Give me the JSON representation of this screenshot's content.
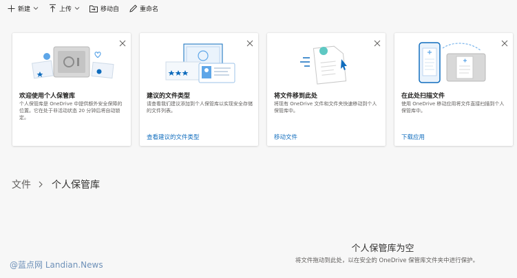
{
  "commandbar": {
    "new_label": "新建",
    "upload_label": "上传",
    "move_label": "移动自",
    "rename_label": "重命名"
  },
  "cards": [
    {
      "title": "欢迎使用个人保管库",
      "description": "个人保管库是 OneDrive 中提供额外安全保障的位置。它在处于非活动状态 20 分钟后将自动锁定。",
      "link": ""
    },
    {
      "title": "建议的文件类型",
      "description": "请查看我们建议添加到个人保管库以实现安全存储的文件列表。",
      "link": "查看建议的文件类型"
    },
    {
      "title": "将文件移到此处",
      "description": "将现有 OneDrive 文件和文件夹快速移动到个人保管库中。",
      "link": "移动文件"
    },
    {
      "title": "在此处扫描文件",
      "description": "使用 OneDrive 移动应用将文件直接扫描到个人保管库中。",
      "link": "下载应用"
    }
  ],
  "breadcrumb": {
    "root": "文件",
    "current": "个人保管库"
  },
  "empty_state": {
    "title": "个人保管库为空",
    "description": "将文件拖动到此处，以在安全的 OneDrive 保管库文件夹中进行保护。"
  },
  "watermark": "@蓝点网 Landian.News",
  "colors": {
    "accent": "#0f6cbd",
    "background": "#f7f7f7"
  }
}
